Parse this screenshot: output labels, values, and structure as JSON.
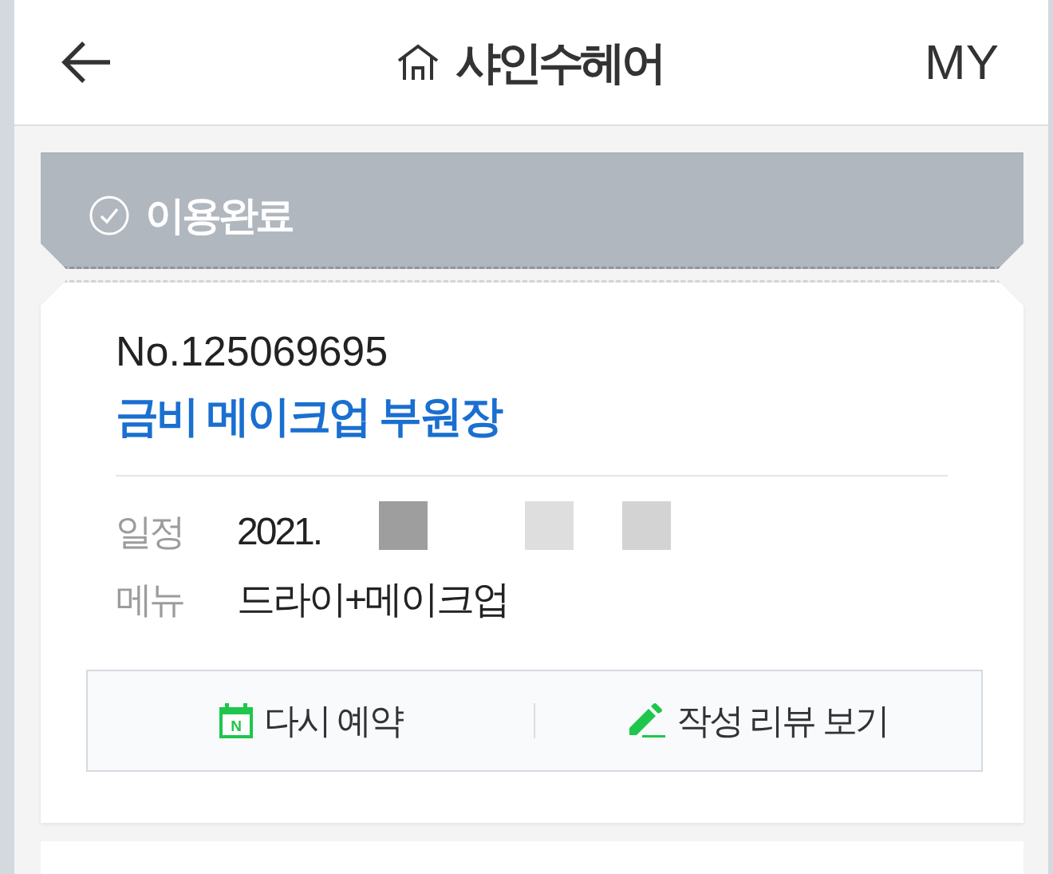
{
  "header": {
    "title": "샤인수헤어",
    "my_link": "MY"
  },
  "reservations": [
    {
      "status": {
        "kind": "completed",
        "label": "이용완료"
      },
      "number": "No.125069695",
      "shop": "금비 메이크업 부원장",
      "details": [
        {
          "label": "일정",
          "value": "2021.",
          "redacted": true
        },
        {
          "label": "메뉴",
          "value": "드라이+메이크업",
          "redacted": false
        }
      ],
      "actions": [
        {
          "kind": "rebook",
          "icon_letter": "N",
          "label": "다시 예약"
        },
        {
          "kind": "review",
          "label": "작성 리뷰 보기"
        }
      ]
    }
  ]
}
